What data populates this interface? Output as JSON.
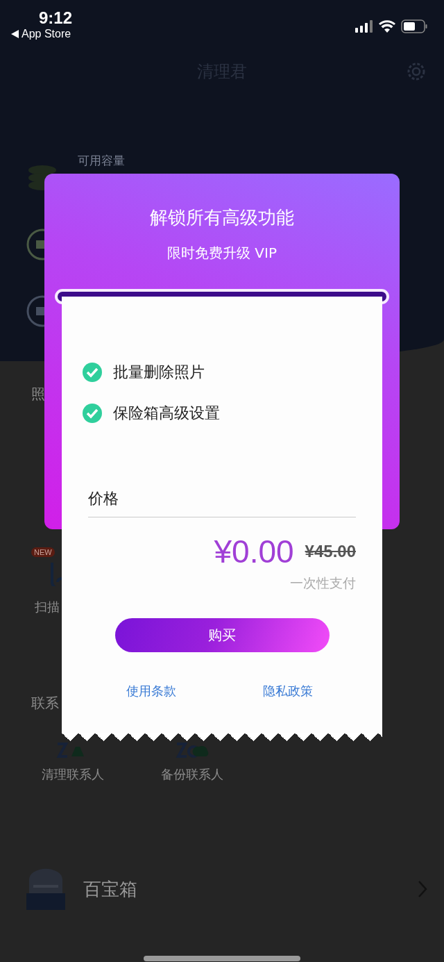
{
  "status_bar": {
    "time": "9:12",
    "back_label": "App Store"
  },
  "header": {
    "title": "清理君"
  },
  "storage": {
    "label": "可用容量"
  },
  "photo_section": {
    "title": "照"
  },
  "scan_tool": {
    "badge": "NEW",
    "label": "扫描"
  },
  "contacts_section": {
    "title": "联系",
    "items": [
      {
        "label": "清理联系人",
        "kind": "clean"
      },
      {
        "label": "备份联系人",
        "kind": "backup"
      }
    ]
  },
  "toolbox": {
    "label": "百宝箱"
  },
  "dialog": {
    "title": "解锁所有高级功能",
    "subtitle": "限时免费升级 VIP",
    "features": [
      {
        "label": "批量删除照片",
        "checked": true
      },
      {
        "label": "保险箱高级设置",
        "checked": true
      }
    ],
    "price_label": "价格",
    "price": "¥0.00",
    "original_price": "¥45.00",
    "payment_note": "一次性支付",
    "buy_button": "购买",
    "links": [
      "使用条款",
      "隐私政策"
    ]
  }
}
